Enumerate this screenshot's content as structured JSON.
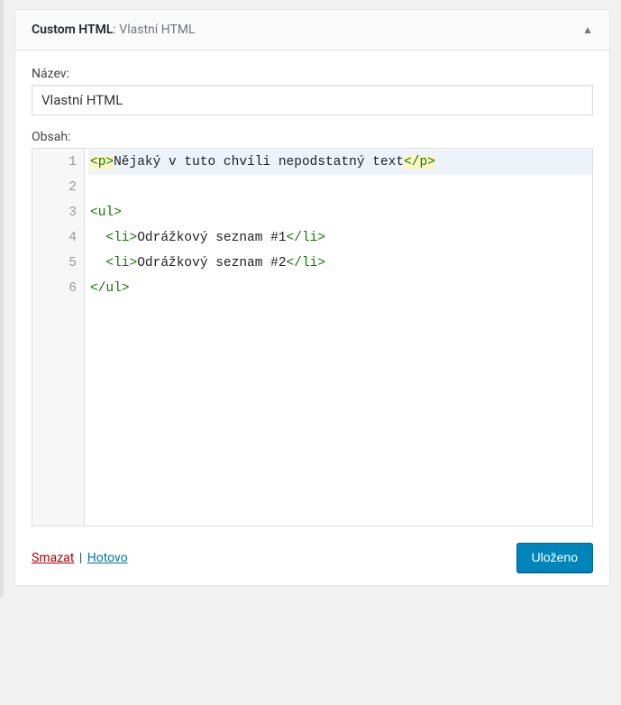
{
  "header": {
    "title_bold": "Custom HTML",
    "title_sep": ": ",
    "title_sub": "Vlastní HTML"
  },
  "fields": {
    "name_label": "Název:",
    "name_value": "Vlastní HTML",
    "content_label": "Obsah:"
  },
  "editor": {
    "line_numbers": [
      "1",
      "2",
      "3",
      "4",
      "5",
      "6"
    ],
    "lines": [
      {
        "active": true,
        "tokens": [
          {
            "t": "tag",
            "hl": true,
            "v": "<p>"
          },
          {
            "t": "txt",
            "v": "Nějaký v tuto chvíli nepodstatný text"
          },
          {
            "t": "tag",
            "hl": true,
            "v": "</p>"
          }
        ]
      },
      {
        "active": false,
        "tokens": []
      },
      {
        "active": false,
        "tokens": [
          {
            "t": "tag",
            "v": "<ul>"
          }
        ]
      },
      {
        "active": false,
        "tokens": [
          {
            "t": "txt",
            "v": "  "
          },
          {
            "t": "tag",
            "v": "<li>"
          },
          {
            "t": "txt",
            "v": "Odrážkový seznam #1"
          },
          {
            "t": "tag",
            "v": "</li>"
          }
        ]
      },
      {
        "active": false,
        "tokens": [
          {
            "t": "txt",
            "v": "  "
          },
          {
            "t": "tag",
            "v": "<li>"
          },
          {
            "t": "txt",
            "v": "Odrážkový seznam #2"
          },
          {
            "t": "tag",
            "v": "</li>"
          }
        ]
      },
      {
        "active": false,
        "tokens": [
          {
            "t": "tag",
            "v": "</ul>"
          }
        ]
      }
    ]
  },
  "footer": {
    "delete": "Smazat",
    "separator": " | ",
    "close": "Hotovo",
    "save": "Uloženo"
  }
}
